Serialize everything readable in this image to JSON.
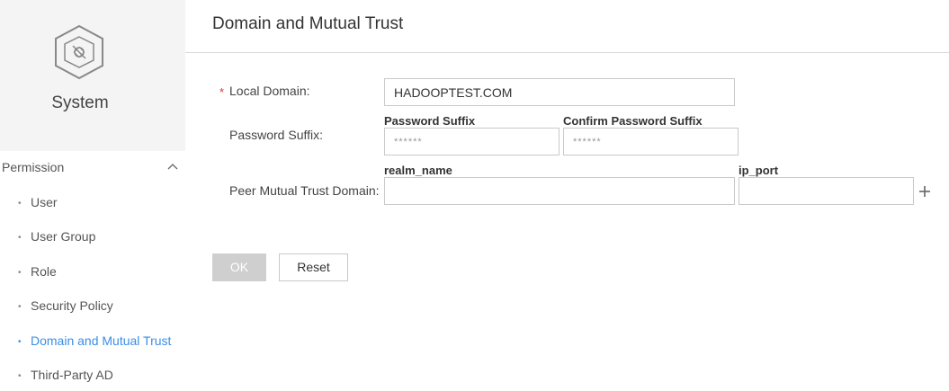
{
  "sidebar": {
    "title": "System",
    "icon": "system-cube-icon",
    "section": {
      "label": "Permission",
      "expanded": true
    },
    "items": [
      {
        "label": "User",
        "active": false
      },
      {
        "label": "User Group",
        "active": false
      },
      {
        "label": "Role",
        "active": false
      },
      {
        "label": "Security Policy",
        "active": false
      },
      {
        "label": "Domain and Mutual Trust",
        "active": true
      },
      {
        "label": "Third-Party AD",
        "active": false
      }
    ],
    "bullet": "•"
  },
  "main": {
    "title": "Domain and Mutual Trust",
    "form": {
      "required_mark": "*",
      "local_domain": {
        "label": "Local Domain:",
        "value": "HADOOPTEST.COM"
      },
      "password_suffix": {
        "label": "Password Suffix:",
        "col1_header": "Password Suffix",
        "col2_header": "Confirm Password Suffix",
        "col1_placeholder": "******",
        "col2_placeholder": "******"
      },
      "peer_trust": {
        "label": "Peer Mutual Trust Domain:",
        "col1_header": "realm_name",
        "col2_header": "ip_port",
        "col1_value": "",
        "col2_value": ""
      }
    },
    "buttons": {
      "ok": "OK",
      "reset": "Reset"
    }
  },
  "colors": {
    "accent": "#3a8ee6",
    "required": "#e03131",
    "sidebar_header_bg": "#f4f4f4",
    "disabled_button": "#cfcfcf"
  }
}
